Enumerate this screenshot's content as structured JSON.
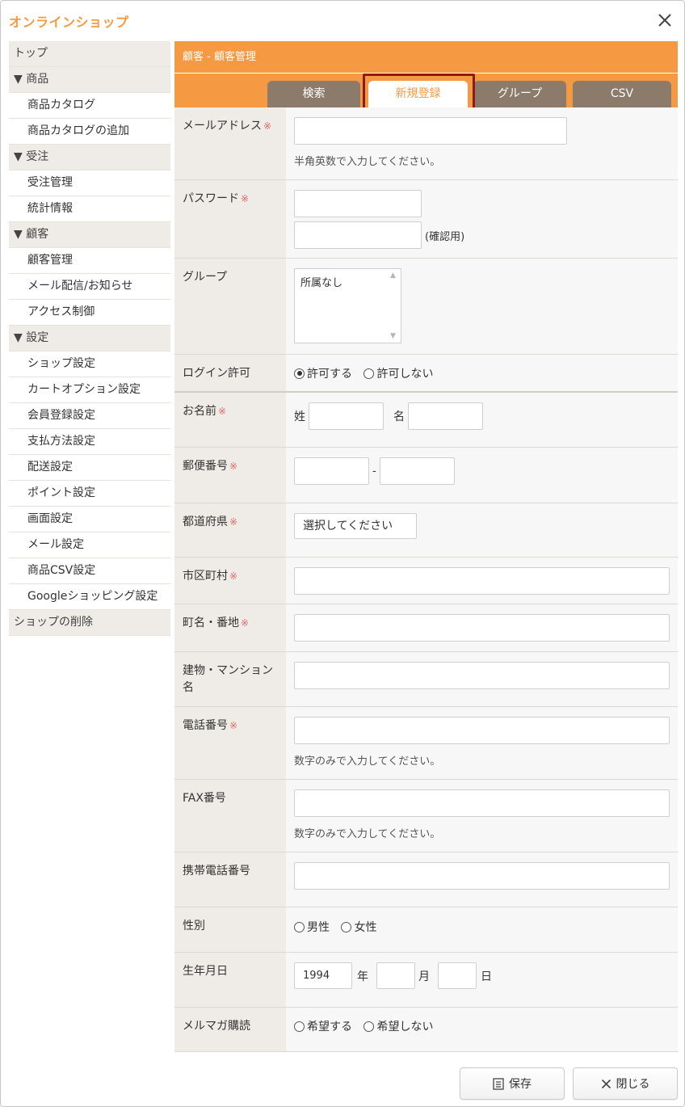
{
  "app": {
    "title": "オンラインショップ"
  },
  "sidebar": {
    "items": [
      {
        "label": "トップ",
        "type": "section"
      },
      {
        "label": "▼ 商品",
        "type": "section"
      },
      {
        "label": "商品カタログ",
        "type": "link"
      },
      {
        "label": "商品カタログの追加",
        "type": "link"
      },
      {
        "label": "▼ 受注",
        "type": "section"
      },
      {
        "label": "受注管理",
        "type": "link"
      },
      {
        "label": "統計情報",
        "type": "link"
      },
      {
        "label": "▼ 顧客",
        "type": "section"
      },
      {
        "label": "顧客管理",
        "type": "link"
      },
      {
        "label": "メール配信/お知らせ",
        "type": "link"
      },
      {
        "label": "アクセス制御",
        "type": "link"
      },
      {
        "label": "▼ 設定",
        "type": "section"
      },
      {
        "label": "ショップ設定",
        "type": "link"
      },
      {
        "label": "カートオプション設定",
        "type": "link"
      },
      {
        "label": "会員登録設定",
        "type": "link"
      },
      {
        "label": "支払方法設定",
        "type": "link"
      },
      {
        "label": "配送設定",
        "type": "link"
      },
      {
        "label": "ポイント設定",
        "type": "link"
      },
      {
        "label": "画面設定",
        "type": "link"
      },
      {
        "label": "メール設定",
        "type": "link"
      },
      {
        "label": "商品CSV設定",
        "type": "link"
      },
      {
        "label": "Googleショッピング設定",
        "type": "link"
      },
      {
        "label": "ショップの削除",
        "type": "section"
      }
    ]
  },
  "main": {
    "header": "顧客 - 顧客管理",
    "tabs": [
      {
        "label": "検索"
      },
      {
        "label": "新規登録",
        "active": true
      },
      {
        "label": "グループ"
      },
      {
        "label": "CSV"
      }
    ]
  },
  "form": {
    "required_mark": "※",
    "email": {
      "label": "メールアドレス",
      "value": "",
      "hint": "半角英数で入力してください。"
    },
    "password": {
      "label": "パスワード",
      "value": "",
      "confirm_value": "",
      "confirm_label": "(確認用)"
    },
    "group": {
      "label": "グループ",
      "options": [
        "所属なし"
      ]
    },
    "login": {
      "label": "ログイン許可",
      "options": [
        "許可する",
        "許可しない"
      ],
      "selected": "許可する"
    },
    "name": {
      "label": "お名前",
      "last_label": "姓",
      "first_label": "名",
      "last_value": "",
      "first_value": ""
    },
    "postal": {
      "label": "郵便番号",
      "sep": "-",
      "value1": "",
      "value2": ""
    },
    "prefecture": {
      "label": "都道府県",
      "selected": "選択してください"
    },
    "city": {
      "label": "市区町村",
      "value": ""
    },
    "street": {
      "label": "町名・番地",
      "value": ""
    },
    "building": {
      "label": "建物・マンション名",
      "value": ""
    },
    "phone": {
      "label": "電話番号",
      "value": "",
      "hint": "数字のみで入力してください。"
    },
    "fax": {
      "label": "FAX番号",
      "value": "",
      "hint": "数字のみで入力してください。"
    },
    "mobile": {
      "label": "携帯電話番号",
      "value": ""
    },
    "gender": {
      "label": "性別",
      "options": [
        "男性",
        "女性"
      ],
      "selected": null
    },
    "birthday": {
      "label": "生年月日",
      "year": "1994",
      "month": "",
      "day": "",
      "year_unit": "年",
      "month_unit": "月",
      "day_unit": "日"
    },
    "newsletter": {
      "label": "メルマガ購読",
      "options": [
        "希望する",
        "希望しない"
      ],
      "selected": null
    }
  },
  "buttons": {
    "save": "保存",
    "close": "閉じる"
  },
  "colors": {
    "accent": "#f59a43",
    "tab_bg": "#8c7a6b",
    "highlight": "#8b1a1a"
  }
}
